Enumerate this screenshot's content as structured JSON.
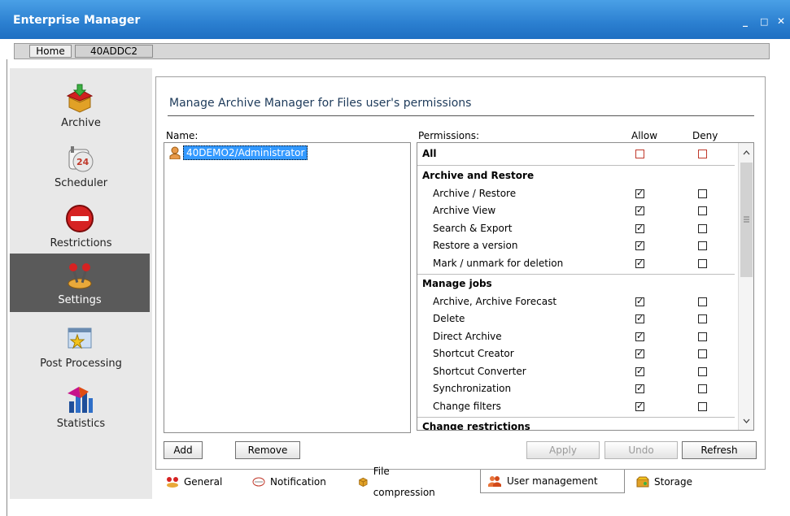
{
  "window": {
    "title": "Enterprise Manager",
    "minimize": "_",
    "maximize": "□",
    "close": "✕"
  },
  "nav_tabs": [
    {
      "label": "Home"
    },
    {
      "label": "40ADDC2"
    }
  ],
  "sidebar": {
    "items": [
      {
        "label": "Archive",
        "icon": "archive-box-icon"
      },
      {
        "label": "Scheduler",
        "icon": "scheduler-clock-icon"
      },
      {
        "label": "Restrictions",
        "icon": "restriction-icon"
      },
      {
        "label": "Settings",
        "icon": "settings-joystick-icon",
        "active": true
      },
      {
        "label": "Post Processing",
        "icon": "post-processing-icon"
      },
      {
        "label": "Statistics",
        "icon": "statistics-icon"
      }
    ]
  },
  "main": {
    "heading": "Manage Archive Manager for Files user's permissions",
    "name_label": "Name:",
    "permissions_label": "Permissions:",
    "allow_label": "Allow",
    "deny_label": "Deny",
    "users": [
      {
        "name": "40DEMO2/Administrator"
      }
    ],
    "rows": [
      {
        "label": "All",
        "kind": "section",
        "allow": false,
        "deny": false
      },
      {
        "label": "Archive and Restore",
        "kind": "header"
      },
      {
        "label": "Archive / Restore",
        "kind": "item",
        "allow": true,
        "deny": false
      },
      {
        "label": "Archive View",
        "kind": "item",
        "allow": true,
        "deny": false
      },
      {
        "label": "Search & Export",
        "kind": "item",
        "allow": true,
        "deny": false
      },
      {
        "label": "Restore a version",
        "kind": "item",
        "allow": true,
        "deny": false
      },
      {
        "label": "Mark / unmark for deletion",
        "kind": "item",
        "allow": true,
        "deny": false
      },
      {
        "label": "Manage jobs",
        "kind": "header"
      },
      {
        "label": "Archive, Archive Forecast",
        "kind": "item",
        "allow": true,
        "deny": false
      },
      {
        "label": "Delete",
        "kind": "item",
        "allow": true,
        "deny": false
      },
      {
        "label": "Direct Archive",
        "kind": "item",
        "allow": true,
        "deny": false
      },
      {
        "label": "Shortcut Creator",
        "kind": "item",
        "allow": true,
        "deny": false
      },
      {
        "label": "Shortcut Converter",
        "kind": "item",
        "allow": true,
        "deny": false
      },
      {
        "label": "Synchronization",
        "kind": "item",
        "allow": true,
        "deny": false
      },
      {
        "label": "Change filters",
        "kind": "item",
        "allow": true,
        "deny": false
      },
      {
        "label": "Change restrictions",
        "kind": "header"
      }
    ],
    "buttons": {
      "add": "Add",
      "remove": "Remove",
      "apply": "Apply",
      "undo": "Undo",
      "refresh": "Refresh"
    }
  },
  "bottom_tabs": [
    {
      "label": "General",
      "icon": "general-icon"
    },
    {
      "label": "Notification",
      "icon": "notification-icon"
    },
    {
      "label": "File compression",
      "icon": "file-compression-icon"
    },
    {
      "label": "User management",
      "icon": "user-management-icon",
      "active": true
    },
    {
      "label": "Storage",
      "icon": "storage-icon"
    }
  ],
  "colors": {
    "titlebar": "#2b7fd0",
    "selection": "#3399ff",
    "active_nav": "#5a5a5a"
  }
}
